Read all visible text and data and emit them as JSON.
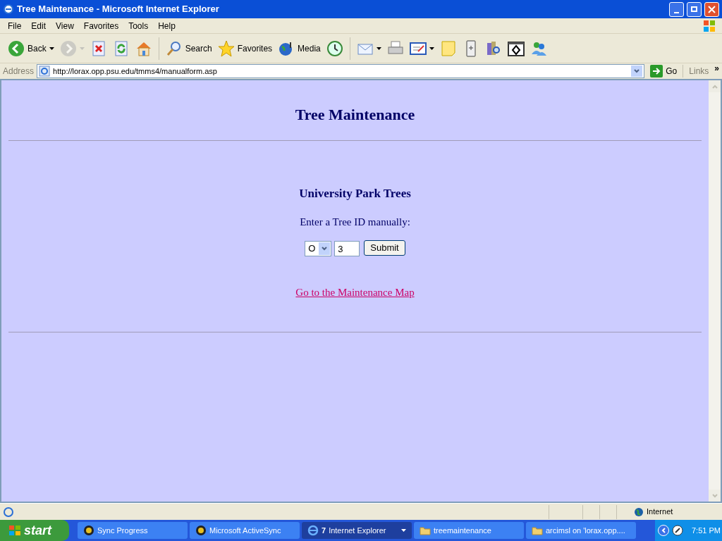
{
  "window": {
    "title": "Tree Maintenance - Microsoft Internet Explorer"
  },
  "menu": [
    "File",
    "Edit",
    "View",
    "Favorites",
    "Tools",
    "Help"
  ],
  "toolbar": [
    {
      "label": "Back",
      "dropdown": true,
      "disabled": false
    },
    {
      "dropdown": true,
      "disabled": true
    },
    {
      "dropdown": false,
      "disabled": false
    },
    {
      "dropdown": false,
      "disabled": false
    },
    {
      "dropdown": false,
      "disabled": false
    },
    {
      "label": "Search",
      "dropdown": false,
      "disabled": false
    },
    {
      "label": "Favorites",
      "dropdown": false,
      "disabled": false
    },
    {
      "label": "Media",
      "dropdown": false,
      "disabled": false
    },
    {
      "dropdown": false,
      "disabled": false
    },
    {
      "dropdown": true,
      "disabled": false
    },
    {
      "dropdown": false,
      "disabled": false
    },
    {
      "dropdown": true,
      "disabled": false
    },
    {
      "dropdown": false,
      "disabled": false
    },
    {
      "dropdown": false,
      "disabled": false
    },
    {
      "dropdown": false,
      "disabled": false
    },
    {
      "dropdown": false,
      "disabled": false
    },
    {
      "dropdown": false,
      "disabled": false
    }
  ],
  "address_bar": {
    "label": "Address",
    "url": "http://lorax.opp.psu.edu/tmms4/manualform.asp",
    "go": "Go",
    "links": "Links",
    "more": "»"
  },
  "page": {
    "heading": "Tree Maintenance",
    "subheading": "University Park Trees",
    "prompt": "Enter a Tree ID manually:",
    "prefix_select": "O",
    "id_value": "3",
    "submit": "Submit",
    "link": "Go to the Maintenance Map"
  },
  "status_bar": {
    "zone": "Internet"
  },
  "taskbar": {
    "start": "start",
    "items": [
      {
        "label": "Sync Progress",
        "selected": false
      },
      {
        "label": "Microsoft ActiveSync",
        "selected": false
      },
      {
        "label": "Internet Explorer",
        "count": "7",
        "selected": true
      },
      {
        "label": "treemaintenance",
        "selected": false
      },
      {
        "label": "arcimsl on 'lorax.opp....",
        "selected": false
      }
    ],
    "clock": "7:51 PM"
  }
}
